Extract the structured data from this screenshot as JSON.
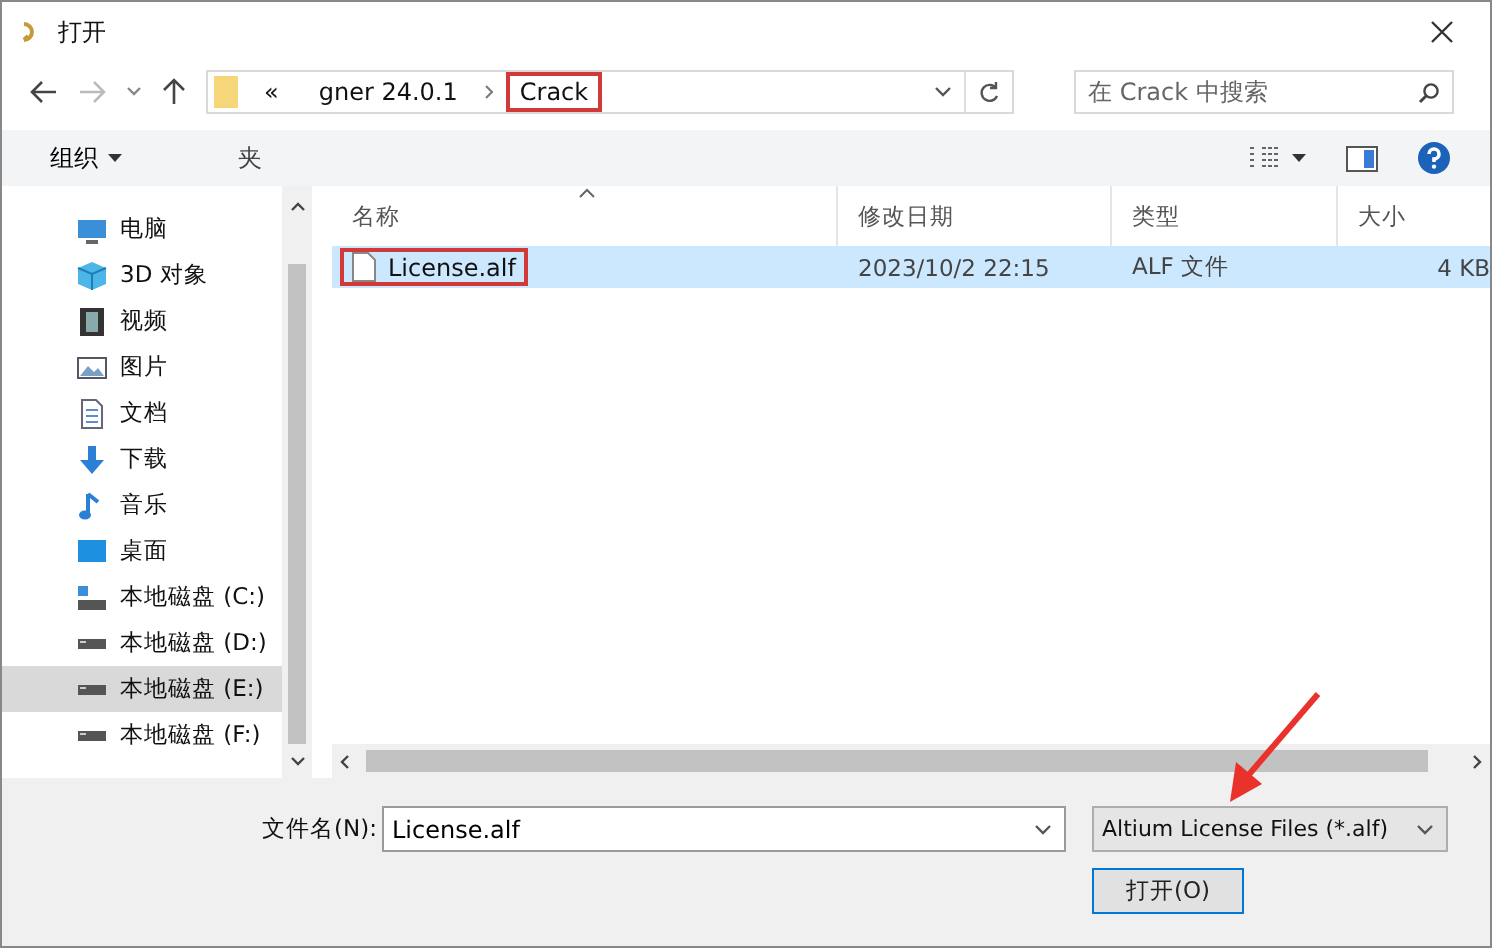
{
  "window": {
    "title": "打开"
  },
  "breadcrumb": [
    {
      "label": "«",
      "highlighted": false
    },
    {
      "label": "gner 24.0.1",
      "highlighted": false
    },
    {
      "label": "Crack",
      "highlighted": true
    }
  ],
  "search": {
    "placeholder": "在 Crack 中搜索"
  },
  "toolbar": {
    "organize": "组织",
    "new_folder": "夹"
  },
  "sidebar": {
    "items": [
      {
        "label": "电脑",
        "kind": "pc",
        "selected": false
      },
      {
        "label": "3D 对象",
        "kind": "cube",
        "selected": false
      },
      {
        "label": "视频",
        "kind": "video",
        "selected": false
      },
      {
        "label": "图片",
        "kind": "picture",
        "selected": false
      },
      {
        "label": "文档",
        "kind": "document",
        "selected": false
      },
      {
        "label": "下载",
        "kind": "download",
        "selected": false
      },
      {
        "label": "音乐",
        "kind": "music",
        "selected": false
      },
      {
        "label": "桌面",
        "kind": "desktop",
        "selected": false
      },
      {
        "label": "本地磁盘 (C:)",
        "kind": "system-drive",
        "selected": false
      },
      {
        "label": "本地磁盘 (D:)",
        "kind": "drive",
        "selected": false
      },
      {
        "label": "本地磁盘 (E:)",
        "kind": "drive",
        "selected": true
      },
      {
        "label": "本地磁盘 (F:)",
        "kind": "drive",
        "selected": false
      }
    ]
  },
  "table": {
    "columns": [
      "名称",
      "修改日期",
      "类型",
      "大小"
    ],
    "rows": [
      {
        "name": "License.alf",
        "modified": "2023/10/2 22:15",
        "type": "ALF 文件",
        "size": "4 KB",
        "selected": true,
        "highlighted": true
      }
    ]
  },
  "footer": {
    "filename_label": "文件名(N):",
    "filename": "License.alf",
    "filter": "Altium License Files (*.alf)",
    "open_button": "打开(O)"
  }
}
